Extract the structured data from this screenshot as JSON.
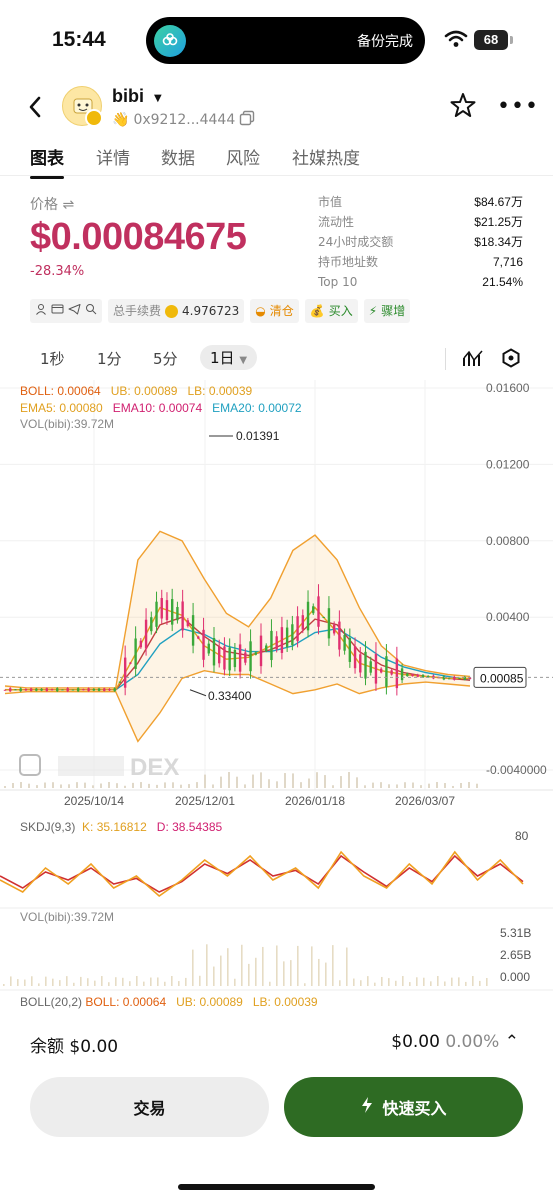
{
  "status": {
    "time": "15:44",
    "island_text": "备份完成",
    "battery": "68"
  },
  "token": {
    "name": "bibi",
    "address": "0x9212...4444"
  },
  "tabs": [
    "图表",
    "详情",
    "数据",
    "风险",
    "社媒热度"
  ],
  "price": {
    "label": "价格",
    "value": "$0.00084675",
    "change": "-28.34%"
  },
  "stats": [
    {
      "k": "市值",
      "v": "$84.67万"
    },
    {
      "k": "流动性",
      "v": "$21.25万"
    },
    {
      "k": "24小时成交额",
      "v": "$18.34万"
    },
    {
      "k": "持币地址数",
      "v": "7,716"
    },
    {
      "k": "Top 10",
      "v": "21.54%"
    }
  ],
  "chips": {
    "fee_label": "总手续费",
    "fee_value": "4.976723",
    "clear": "清仓",
    "buy": "买入",
    "surge": "骤增"
  },
  "intervals": [
    "1秒",
    "1分",
    "5分",
    "1日"
  ],
  "legends": {
    "boll": "BOLL: 0.00064",
    "ub": "UB: 0.00089",
    "lb": "LB: 0.00039",
    "ema5": "EMA5: 0.00080",
    "ema10": "EMA10: 0.00074",
    "ema20": "EMA20: 0.00072",
    "vol": "VOL(bibi):39.72M",
    "skdj_name": "SKDJ(9,3)",
    "skdj_k": "K: 35.16812",
    "skdj_d": "D: 38.54385",
    "vol2": "VOL(bibi):39.72M",
    "boll2_name": "BOLL(20,2)",
    "boll2": "BOLL: 0.00064",
    "ub2": "UB: 0.00089",
    "lb2": "LB: 0.00039"
  },
  "chart_data": [
    {
      "type": "line",
      "title": "",
      "x_ticks": [
        "2025/10/14",
        "2025/12/01",
        "2026/01/18",
        "2026/03/07"
      ],
      "y_ticks": [
        "0.01600",
        "0.01200",
        "0.00800",
        "0.00400",
        "-0.0040000"
      ],
      "ylim": [
        -0.004,
        0.016
      ],
      "annotations": {
        "high": "0.01391",
        "low": "0.33400",
        "last": "0.00085"
      },
      "series": [
        {
          "name": "EMA5",
          "values": [
            0.0002,
            0.0002,
            0.0002,
            0.0002,
            0.0002,
            0.0002,
            0.0023,
            0.0045,
            0.0041,
            0.0025,
            0.0018,
            0.0019,
            0.0025,
            0.0031,
            0.0045,
            0.0032,
            0.0016,
            0.0012,
            0.001,
            0.0009,
            0.0008,
            0.0008
          ]
        },
        {
          "name": "EMA10",
          "values": [
            0.0002,
            0.0002,
            0.0002,
            0.0002,
            0.0002,
            0.0002,
            0.0016,
            0.0036,
            0.004,
            0.003,
            0.0022,
            0.002,
            0.0023,
            0.0028,
            0.0039,
            0.0036,
            0.0022,
            0.0015,
            0.0011,
            0.0009,
            0.0008,
            0.0007
          ]
        },
        {
          "name": "EMA20",
          "values": [
            0.0002,
            0.0002,
            0.0002,
            0.0002,
            0.0002,
            0.0002,
            0.001,
            0.0026,
            0.0034,
            0.0031,
            0.0025,
            0.0022,
            0.0022,
            0.0025,
            0.0032,
            0.0034,
            0.0027,
            0.0019,
            0.0014,
            0.0011,
            0.0009,
            0.0007
          ]
        },
        {
          "name": "UB",
          "values": [
            0.0004,
            0.0003,
            0.0003,
            0.0003,
            0.0003,
            0.0003,
            0.007,
            0.0085,
            0.008,
            0.006,
            0.0042,
            0.0035,
            0.005,
            0.0075,
            0.0083,
            0.007,
            0.0045,
            0.0025,
            0.0015,
            0.0012,
            0.001,
            0.0009
          ]
        },
        {
          "name": "LB",
          "values": [
            0.0,
            0.0001,
            0.0001,
            0.0001,
            0.0001,
            0.0001,
            -0.0025,
            -0.001,
            0.0008,
            0.0012,
            0.001,
            0.001,
            0.0005,
            0.0,
            0.0002,
            0.0005,
            0.0,
            0.0003,
            0.0005,
            0.0006,
            0.0005,
            0.0004
          ]
        }
      ]
    },
    {
      "type": "line",
      "title": "",
      "y_ticks": [
        "80"
      ],
      "series": [
        {
          "name": "K",
          "values": [
            40,
            25,
            55,
            35,
            60,
            30,
            45,
            20,
            40,
            65,
            45,
            70,
            40,
            55,
            30,
            75,
            45,
            30,
            60,
            35,
            75,
            40,
            65,
            35
          ]
        },
        {
          "name": "D",
          "values": [
            45,
            30,
            50,
            40,
            55,
            35,
            42,
            25,
            38,
            60,
            48,
            65,
            45,
            52,
            35,
            70,
            50,
            32,
            55,
            38,
            70,
            45,
            60,
            38
          ]
        }
      ]
    },
    {
      "type": "bar",
      "title": "",
      "y_ticks": [
        "5.31B",
        "2.65B",
        "0.000"
      ]
    }
  ],
  "bottom": {
    "balance": "余额 $0.00",
    "right_value": "$0.00",
    "right_pct": "0.00%",
    "trade": "交易",
    "quick_buy": "快速买入"
  }
}
